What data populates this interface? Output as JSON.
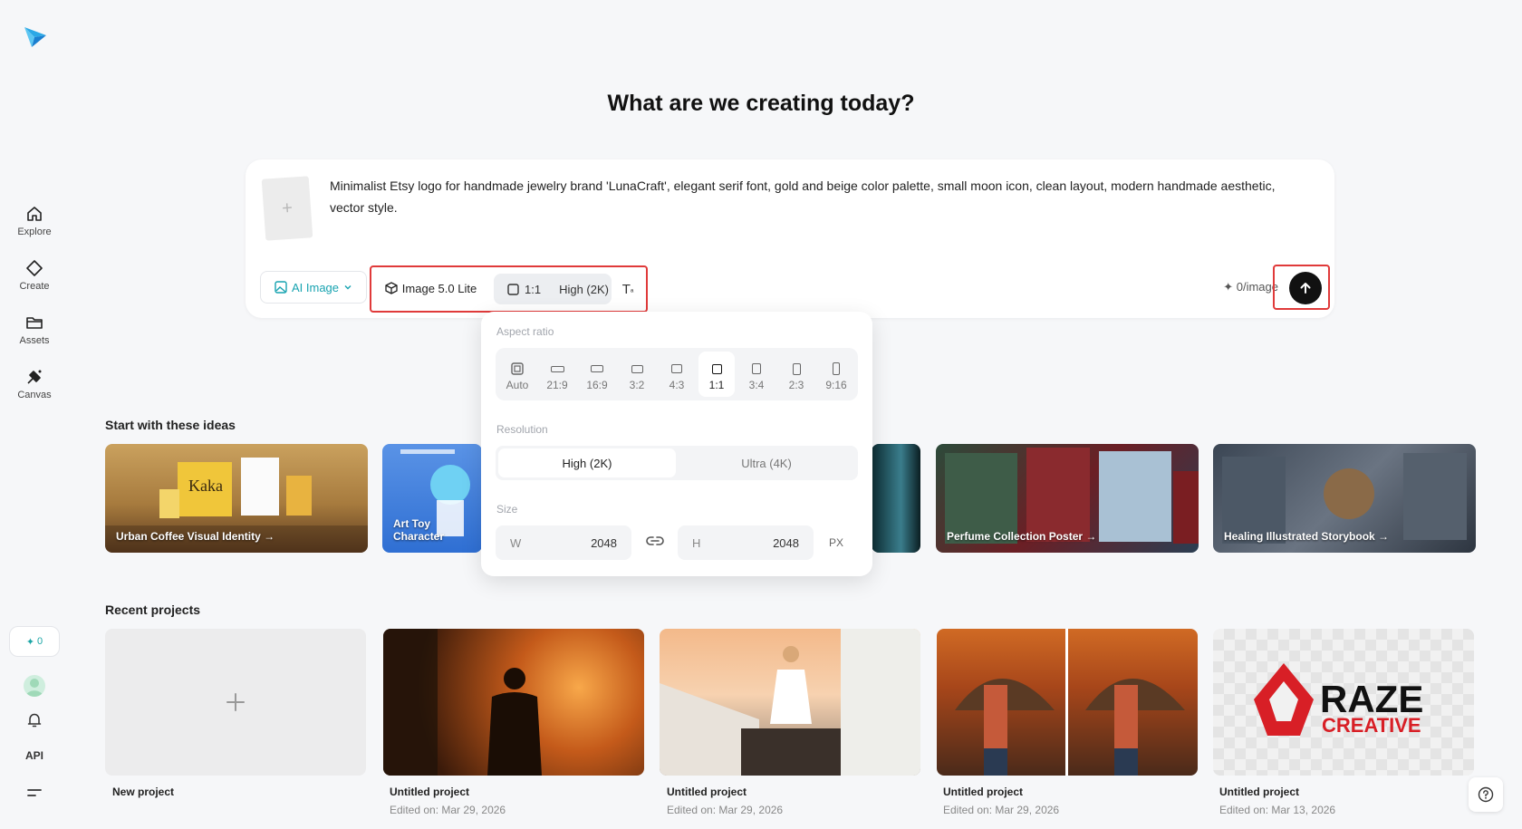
{
  "sidebar": {
    "items": [
      {
        "label": "Explore"
      },
      {
        "label": "Create"
      },
      {
        "label": "Assets"
      },
      {
        "label": "Canvas"
      }
    ],
    "credits": "0",
    "api_label": "API"
  },
  "headline": "What are we creating today?",
  "prompt": {
    "text": "Minimalist Etsy logo for handmade jewelry brand 'LunaCraft', elegant serif font, gold and beige color palette, small moon icon, clean layout, modern handmade aesthetic, vector style.",
    "mode_label": "AI Image",
    "model_label": "Image 5.0 Lite",
    "ratio_label": "1:1",
    "quality_label": "High (2K)",
    "credits_hint": "0/image"
  },
  "popover": {
    "aspect_label": "Aspect ratio",
    "ratios": [
      "Auto",
      "21:9",
      "16:9",
      "3:2",
      "4:3",
      "1:1",
      "3:4",
      "2:3",
      "9:16"
    ],
    "selected_ratio": "1:1",
    "resolution_label": "Resolution",
    "resolutions": [
      "High (2K)",
      "Ultra (4K)"
    ],
    "selected_resolution": "High (2K)",
    "size_label": "Size",
    "width_key": "W",
    "width_value": "2048",
    "height_key": "H",
    "height_value": "2048",
    "unit": "PX"
  },
  "ideas": {
    "title": "Start with these ideas",
    "items": [
      {
        "caption": "Urban Coffee Visual Identity →"
      },
      {
        "caption": "Art Toy Character"
      },
      {
        "caption": ""
      },
      {
        "caption": "Perfume Collection Poster →"
      },
      {
        "caption": "Healing Illustrated Storybook →"
      }
    ]
  },
  "recent": {
    "title": "Recent projects",
    "items": [
      {
        "title": "New project",
        "date": ""
      },
      {
        "title": "Untitled project",
        "date": "Edited on: Mar 29, 2026"
      },
      {
        "title": "Untitled project",
        "date": "Edited on: Mar 29, 2026"
      },
      {
        "title": "Untitled project",
        "date": "Edited on: Mar 29, 2026"
      },
      {
        "title": "Untitled project",
        "date": "Edited on: Mar 13, 2026"
      }
    ],
    "raze_logo_text": "RAZE",
    "raze_logo_sub": "CREATIVE"
  },
  "colors": {
    "accent_teal": "#17a3b0",
    "highlight_red": "#e03a3a",
    "send_button": "#111111"
  }
}
